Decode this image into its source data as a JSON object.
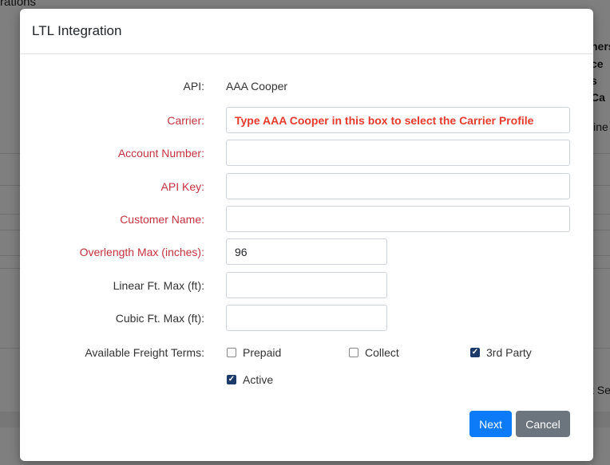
{
  "background": {
    "title_fragment": "rations",
    "right_fragments": [
      "ners",
      "ce",
      "s",
      "Ca",
      "line",
      "t Se"
    ]
  },
  "modal": {
    "title": "LTL Integration",
    "api": {
      "label": "API:",
      "value": "AAA Cooper"
    },
    "carrier": {
      "label": "Carrier:",
      "placeholder": "Type AAA Cooper in this box to select the Carrier Profile",
      "value": ""
    },
    "account_number": {
      "label": "Account Number:",
      "value": ""
    },
    "api_key": {
      "label": "API Key:",
      "value": ""
    },
    "customer_name": {
      "label": "Customer Name:",
      "value": ""
    },
    "overlength_max": {
      "label": "Overlength Max (inches):",
      "value": "96"
    },
    "linear_ft_max": {
      "label": "Linear Ft. Max (ft):",
      "value": ""
    },
    "cubic_ft_max": {
      "label": "Cubic Ft. Max (ft):",
      "value": ""
    },
    "freight_terms": {
      "label": "Available Freight Terms:",
      "options": [
        {
          "label": "Prepaid",
          "checked": false
        },
        {
          "label": "Collect",
          "checked": false
        },
        {
          "label": "3rd Party",
          "checked": true
        }
      ]
    },
    "active": {
      "label": "Active",
      "checked": true
    },
    "buttons": {
      "next": "Next",
      "cancel": "Cancel"
    },
    "colors": {
      "required_label": "#c3333f",
      "primary": "#0d7bf7",
      "secondary": "#6c757d",
      "checkbox_on": "#1c3b6a"
    }
  }
}
